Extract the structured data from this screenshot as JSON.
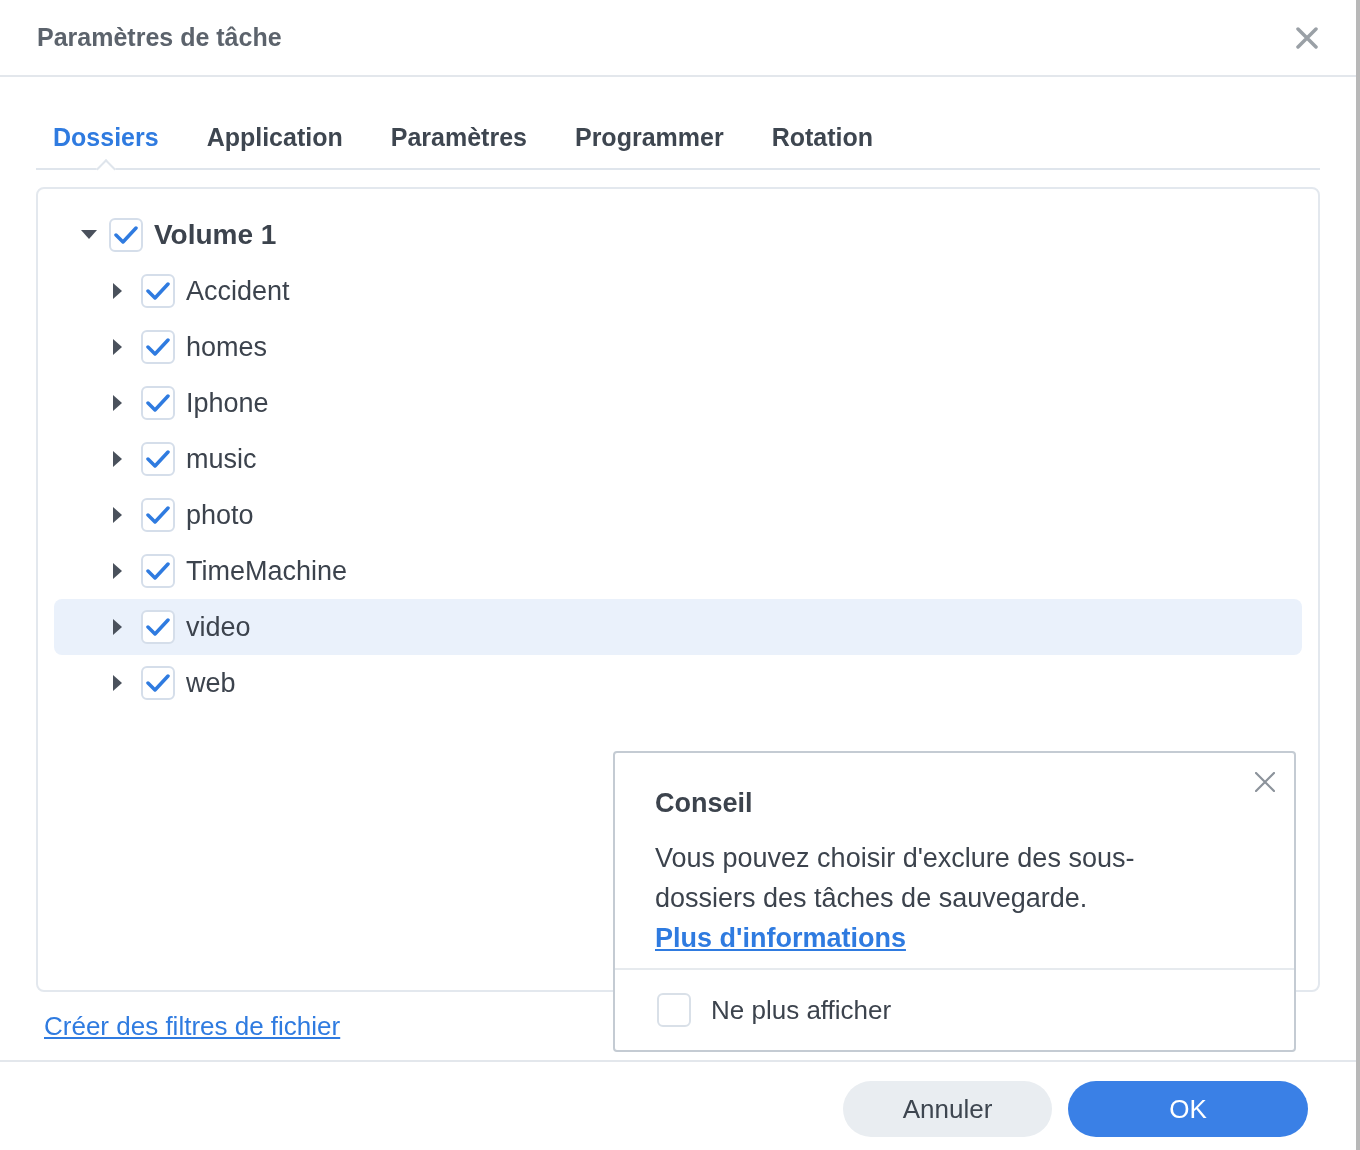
{
  "window": {
    "title": "Paramètres de tâche"
  },
  "tabs": [
    {
      "label": "Dossiers",
      "selected": true
    },
    {
      "label": "Application",
      "selected": false
    },
    {
      "label": "Paramètres",
      "selected": false
    },
    {
      "label": "Programmer",
      "selected": false
    },
    {
      "label": "Rotation",
      "selected": false
    }
  ],
  "tree": [
    {
      "label": "Volume 1",
      "checked": true,
      "expanded": true,
      "selected": false,
      "children": [
        {
          "label": "Accident",
          "checked": true,
          "expanded": false,
          "selected": false
        },
        {
          "label": "homes",
          "checked": true,
          "expanded": false,
          "selected": false
        },
        {
          "label": "Iphone",
          "checked": true,
          "expanded": false,
          "selected": false
        },
        {
          "label": "music",
          "checked": true,
          "expanded": false,
          "selected": false
        },
        {
          "label": "photo",
          "checked": true,
          "expanded": false,
          "selected": false
        },
        {
          "label": "TimeMachine",
          "checked": true,
          "expanded": false,
          "selected": false
        },
        {
          "label": "video",
          "checked": true,
          "expanded": false,
          "selected": true
        },
        {
          "label": "web",
          "checked": true,
          "expanded": false,
          "selected": false
        }
      ]
    }
  ],
  "filters_link": "Créer des filtres de fichier",
  "tip": {
    "title": "Conseil",
    "text": "Vous pouvez choisir d'exclure des sous-dossiers des tâches de sauvegarde.",
    "link": "Plus d'informations",
    "dont_show": {
      "label": "Ne plus afficher",
      "checked": false
    }
  },
  "buttons": [
    {
      "label": "Annuler",
      "kind": "secondary"
    },
    {
      "label": "OK",
      "kind": "primary"
    }
  ]
}
